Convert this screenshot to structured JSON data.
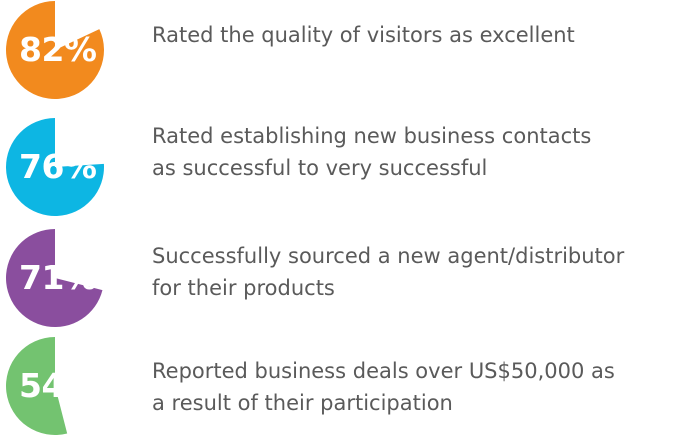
{
  "chart_data": {
    "type": "pie",
    "charts": [
      {
        "label": "82%",
        "value": 82,
        "color": "#F28A1E",
        "lines": [
          "Rated the quality of visitors as excellent"
        ]
      },
      {
        "label": "76%",
        "value": 76,
        "color": "#0DB6E3",
        "lines": [
          "Rated establishing new business contacts",
          "as successful to very successful"
        ]
      },
      {
        "label": "71%",
        "value": 71,
        "color": "#8A4E9E",
        "lines": [
          "Successfully sourced a new agent/distributor",
          "for their products"
        ]
      },
      {
        "label": "54%",
        "value": 54,
        "color": "#73C370",
        "lines": [
          "Reported business deals over US$50,000 as",
          "a result of their participation"
        ]
      }
    ],
    "remainder_color": "#ffffff"
  }
}
